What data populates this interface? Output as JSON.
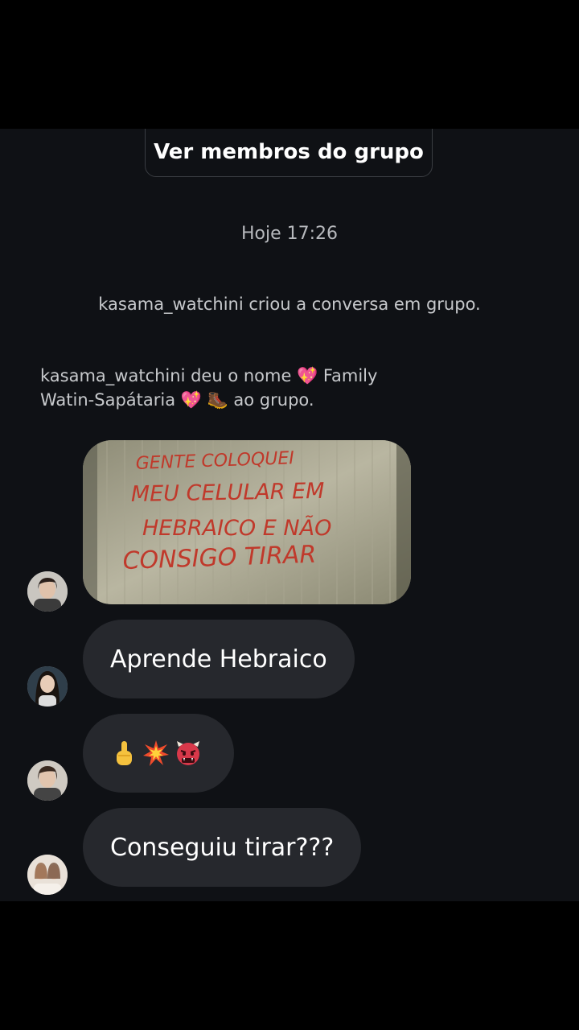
{
  "header": {
    "members_button": "Ver membros do grupo"
  },
  "timestamp": "Hoje 17:26",
  "system_messages": {
    "created": "kasama_watchini criou a conversa em grupo.",
    "renamed_line1": "kasama_watchini deu o nome 💖 Family",
    "renamed_line2": "Watin-Sapátaria 💖 🥾 ao grupo."
  },
  "photo_text": [
    "GENTE COLOQUEI",
    "MEU CELULAR EM",
    "HEBRAICO E NÃO",
    "CONSIGO TIRAR"
  ],
  "messages": [
    {
      "text": "Aprende Hebraico"
    },
    {
      "emojis": [
        "middle-finger-emoji",
        "collision-emoji",
        "ogre-emoji"
      ]
    },
    {
      "text": "Conseguiu tirar???"
    }
  ],
  "colors": {
    "background": "#0f1115",
    "bubble": "#26282d",
    "system_text": "#c7c9cc",
    "photo_ink": "#c0392b"
  }
}
